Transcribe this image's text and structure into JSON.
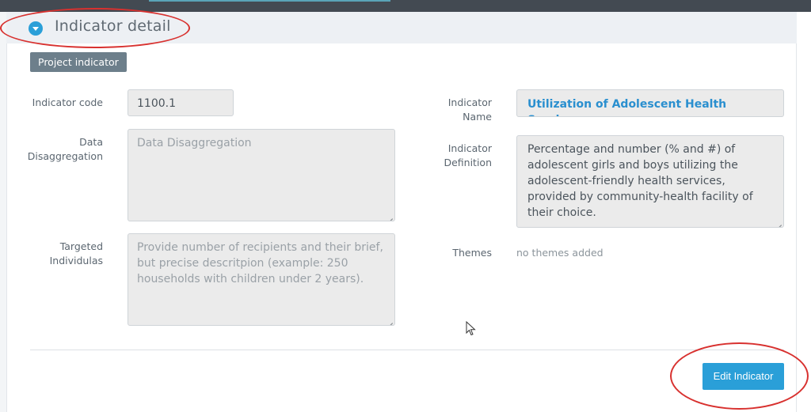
{
  "header": {
    "title": "Indicator detail"
  },
  "badge": {
    "label": "Project indicator"
  },
  "fields": {
    "indicator_code": {
      "label": "Indicator code",
      "value": "1100.1"
    },
    "data_disaggregation": {
      "label": "Data\nDisaggregation",
      "placeholder": "Data Disaggregation"
    },
    "targeted_individuals": {
      "label": "Targeted\nIndividulas",
      "placeholder": "Provide number of recipients and their brief, but precise descritpion (example: 250 households with children under 2 years)."
    },
    "indicator_name": {
      "label": "Indicator\nName",
      "value": "Utilization of Adolescent Health Services"
    },
    "indicator_definition": {
      "label": "Indicator\nDefinition",
      "value": "Percentage and number (% and #) of adolescent girls and boys utilizing the adolescent-friendly health services, provided by community-health facility of their choice."
    },
    "themes": {
      "label": "Themes",
      "value": "no themes added"
    }
  },
  "actions": {
    "edit_label": "Edit Indicator"
  },
  "colors": {
    "accent": "#2a9fd8",
    "badge": "#6d7f8b",
    "annotation": "#d8312f",
    "topbar": "#434a52"
  }
}
